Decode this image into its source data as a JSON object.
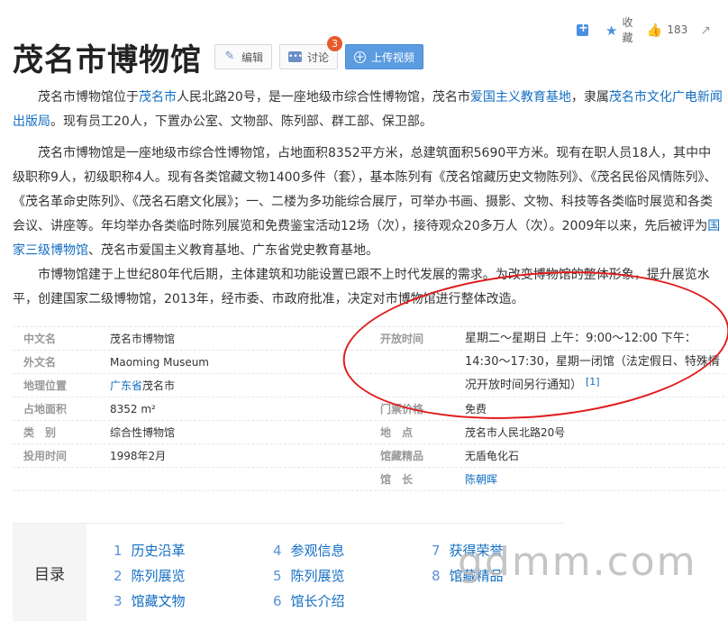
{
  "tools": {
    "collect_label": "收藏",
    "like_count": "183"
  },
  "header": {
    "title": "茂名市博物馆",
    "edit_label": "编辑",
    "discuss_label": "讨论",
    "discuss_badge": "3",
    "upload_label": "上传视频"
  },
  "para1": {
    "t1": "茂名市博物馆位于",
    "l1": "茂名市",
    "t2": "人民北路20号，是一座地级市综合性博物馆，茂名市",
    "l2": "爱国主义教育基地",
    "t3": "，隶属",
    "l3": "茂名市文化广电新闻出版局",
    "t4": "。现有员工20人，下置办公室、文物部、陈列部、群工部、保卫部。"
  },
  "para2": {
    "t1": "茂名市博物馆是一座地级市综合性博物馆，占地面积8352平方米，总建筑面积5690平方米。现有在职人员18人，其中中级职称9人，初级职称4人。现有各类馆藏文物1400多件（套），基本陈列有《茂名馆藏历史文物陈列》、《茂名民俗风情陈列》、《茂名革命史陈列》、《茂名石磨文化展》；一、二楼为多功能综合展厅，可举办书画、摄影、文物、科技等各类临时展览和各类会议、讲座等。年均举办各类临时陈列展览和免费鉴宝活动12场（次），接待观众20多万人（次）。2009年以来，先后被评为",
    "l1": "国家三级博物馆",
    "t2": "、茂名市爱国主义教育基地、广东省党史教育基地。"
  },
  "para3": {
    "t1": "市博物馆建于上世纪80年代后期，主体建筑和功能设置已跟不上时代发展的需求。为改变博物馆的整体形象，提升展览水平，创建国家二级博物馆，2013年，经市委、市政府批准，决定对市博物馆进行整体改造。"
  },
  "info": {
    "chinese_name_k": "中文名",
    "chinese_name_v": "茂名市博物馆",
    "foreign_name_k": "外文名",
    "foreign_name_v": "Maoming Museum",
    "location_k": "地理位置",
    "location_link": "广东省",
    "location_v": "茂名市",
    "area_k": "占地面积",
    "area_v": "8352 m²",
    "type_k": "类　别",
    "type_v": "综合性博物馆",
    "opened_k": "投用时间",
    "opened_v": "1998年2月",
    "hours_k": "开放时间",
    "hours_v": "星期二～星期日 上午：9:00～12:00 下午：14:30～17:30，星期一闭馆（法定假日、特殊情况开放时间另行通知）",
    "hours_ref": "[1]",
    "ticket_k": "门票价格",
    "ticket_v": "免费",
    "address_k": "地　点",
    "address_v": "茂名市人民北路20号",
    "treasure_k": "馆藏精品",
    "treasure_v": "无盾龟化石",
    "curator_k": "馆　长",
    "curator_v": "陈朝晖"
  },
  "toc": {
    "label": "目录",
    "items": [
      {
        "num": "1",
        "label": "历史沿革"
      },
      {
        "num": "2",
        "label": "陈列展览"
      },
      {
        "num": "3",
        "label": "馆藏文物"
      },
      {
        "num": "4",
        "label": "参观信息"
      },
      {
        "num": "5",
        "label": "陈列展览"
      },
      {
        "num": "6",
        "label": "馆长介绍"
      },
      {
        "num": "7",
        "label": "获得荣誉"
      },
      {
        "num": "8",
        "label": "馆藏精品"
      }
    ]
  },
  "watermark": "gdmm.com",
  "colors": {
    "link": "#136ec2",
    "annotation_circle": "#e01b1b",
    "upload_button": "#5b9ce0",
    "badge": "#e85a2c"
  }
}
